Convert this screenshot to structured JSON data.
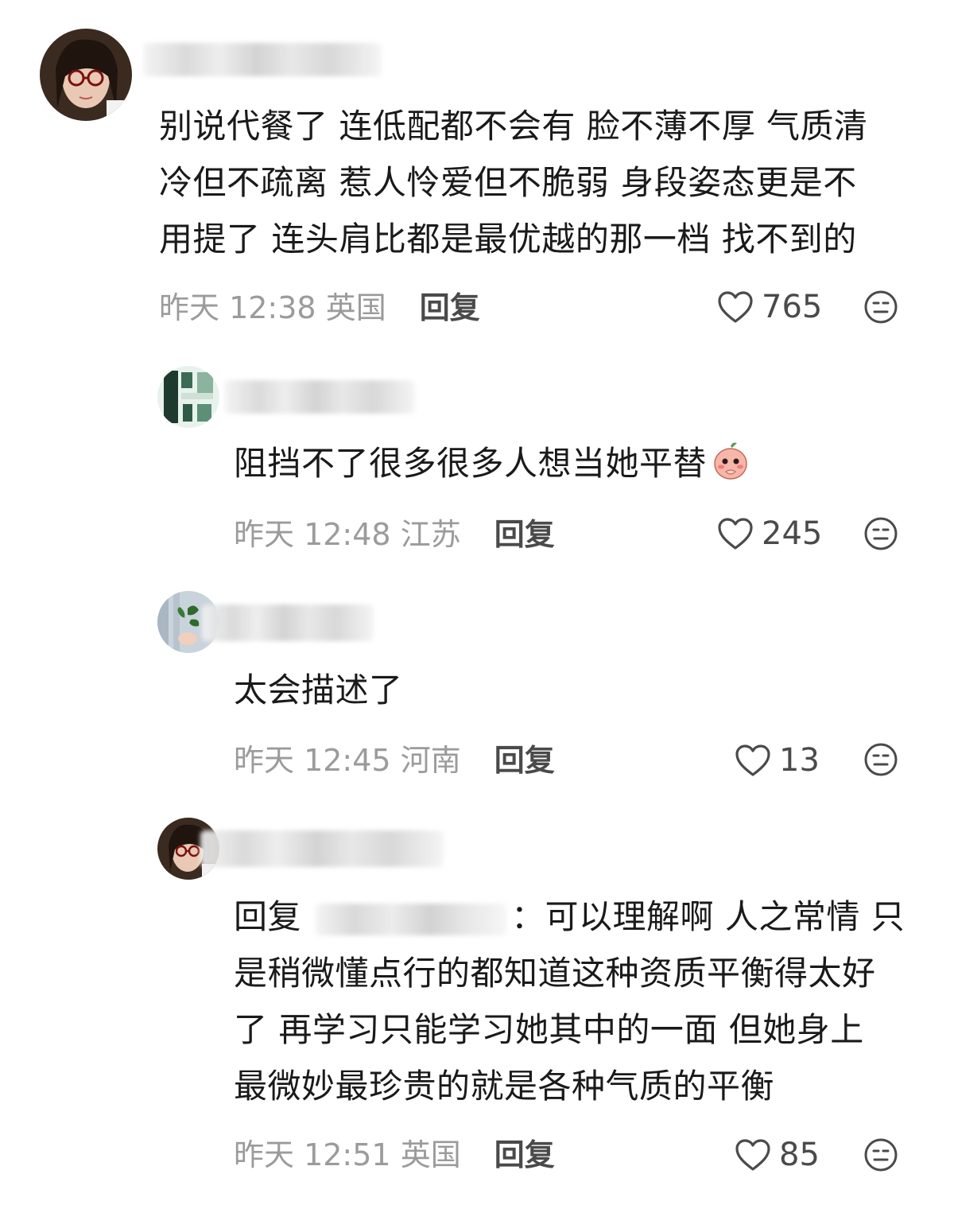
{
  "comments": [
    {
      "text_lines": [
        "别说代餐了 连低配都不会有 脸不薄不厚 气质清",
        "冷但不疏离 惹人怜爱但不脆弱 身段姿态更是不",
        "用提了 连头肩比都是最优越的那一档 找不到的"
      ],
      "time": "昨天 12:38",
      "location": "英国",
      "reply_label": "回复",
      "likes": "765",
      "avatar_icon": "avatar-girl-glasses"
    },
    {
      "text": "阻挡不了很多很多人想当她平替",
      "emoji": "peach-shy-emoji",
      "time": "昨天 12:48",
      "location": "江苏",
      "reply_label": "回复",
      "likes": "245",
      "avatar_icon": "avatar-book-cover"
    },
    {
      "text": "太会描述了",
      "time": "昨天 12:45",
      "location": "河南",
      "reply_label": "回复",
      "likes": "13",
      "avatar_icon": "avatar-leaf-hand"
    },
    {
      "reply_prefix": "回复",
      "reply_colon": "：",
      "text_first": "可以理解啊 人之常情 只",
      "text_lines": [
        "是稍微懂点行的都知道这种资质平衡得太好",
        "了 再学习只能学习她其中的一面 但她身上",
        "最微妙最珍贵的就是各种气质的平衡"
      ],
      "time": "昨天 12:51",
      "location": "英国",
      "reply_label": "回复",
      "likes": "85",
      "avatar_icon": "avatar-girl-glasses"
    }
  ],
  "colors": {
    "meta_gray": "#9b9b9b",
    "reply_dark": "#4a4a4a",
    "text": "#1a1a1a"
  }
}
